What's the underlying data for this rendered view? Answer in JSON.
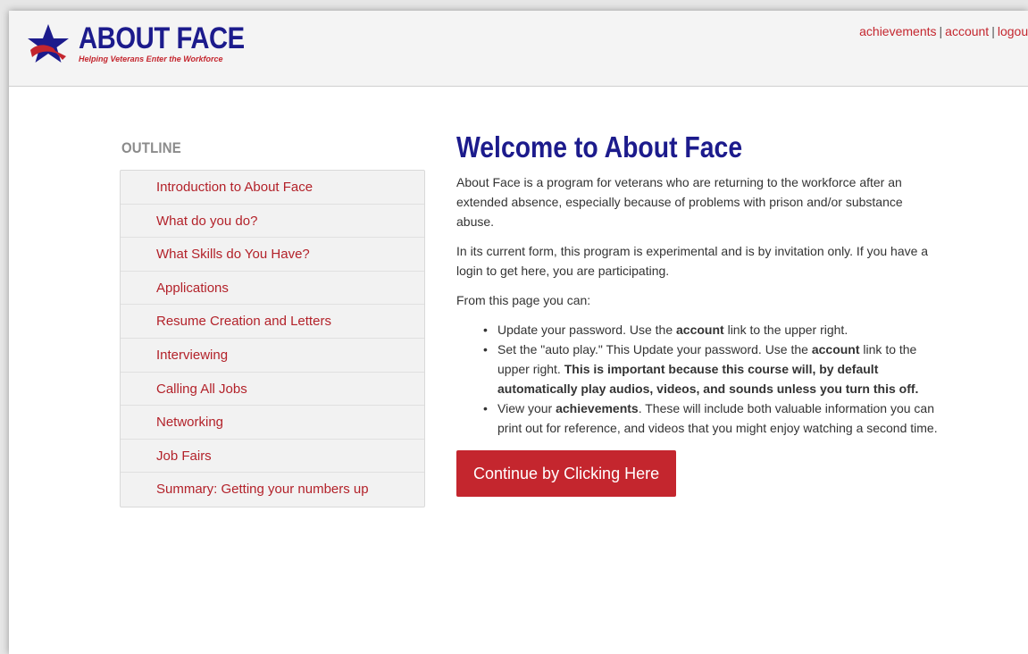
{
  "header": {
    "logo_title": "ABOUT FACE",
    "logo_tagline": "Helping Veterans Enter the Workforce",
    "links": {
      "achievements": "achievements",
      "account": "account",
      "logout": "logout",
      "separator": "|"
    }
  },
  "sidebar": {
    "title": "OUTLINE",
    "items": [
      "Introduction to About Face",
      "What do you do?",
      "What Skills do You Have?",
      "Applications",
      "Resume Creation and Letters",
      "Interviewing",
      "Calling All Jobs",
      "Networking",
      "Job Fairs",
      "Summary: Getting your numbers up"
    ]
  },
  "main": {
    "heading": "Welcome to About Face",
    "paragraph1": "About Face is a program for veterans who are returning to the workforce after an extended absence, especially because of problems with prison and/or substance abuse.",
    "paragraph2": "In its current form, this program is experimental and is by invitation only. If you have a login to get here, you are participating.",
    "paragraph3": "From this page you can:",
    "bullets": {
      "b1_pre": "Update your password. Use the ",
      "b1_bold": "account",
      "b1_post": " link to the upper right.",
      "b2_pre": "Set the \"auto play.\" This Update your password. Use the ",
      "b2_bold1": "account",
      "b2_mid": " link to the upper right. ",
      "b2_bold2": "This is important because this course will, by default automatically play audios, videos, and sounds unless you turn this off.",
      "b3_pre": "View your ",
      "b3_bold": "achievements",
      "b3_post": ". These will include both valuable information you can print out for reference, and videos that you might enjoy watching a second time."
    },
    "continue_label": "Continue by Clicking Here"
  },
  "colors": {
    "brand_blue": "#1c1b8c",
    "accent_red": "#c4262e"
  }
}
